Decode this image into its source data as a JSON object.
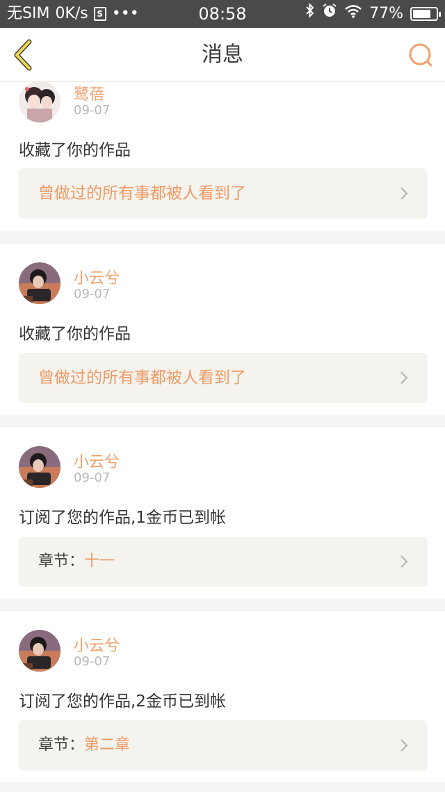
{
  "status_bar": {
    "carrier": "无SIM",
    "net_speed": "0K/s",
    "sim_icon_letter": "S",
    "more": "•••",
    "time": "08:58",
    "battery_text": "77%",
    "battery_level": 0.77,
    "icons": [
      "bluetooth-icon",
      "alarm-icon",
      "wifi-icon",
      "battery-icon"
    ]
  },
  "nav": {
    "title": "消息",
    "back_icon": "chevron-left-icon",
    "search_icon": "search-icon",
    "accent_color": "#f2a06b"
  },
  "messages": [
    {
      "user": "鹭蓓",
      "date": "09-07",
      "action": "收藏了你的作品",
      "link_title": "曾做过的所有事都被人看到了"
    },
    {
      "user": "小云兮",
      "date": "09-07",
      "action": "收藏了你的作品",
      "link_title": "曾做过的所有事都被人看到了"
    },
    {
      "user": "小云兮",
      "date": "09-07",
      "action": "订阅了您的作品,1金币已到帐",
      "chapter_label": "章节：",
      "chapter_value": "十一"
    },
    {
      "user": "小云兮",
      "date": "09-07",
      "action": "订阅了您的作品,2金币已到帐",
      "chapter_label": "章节：",
      "chapter_value": "第二章"
    }
  ]
}
